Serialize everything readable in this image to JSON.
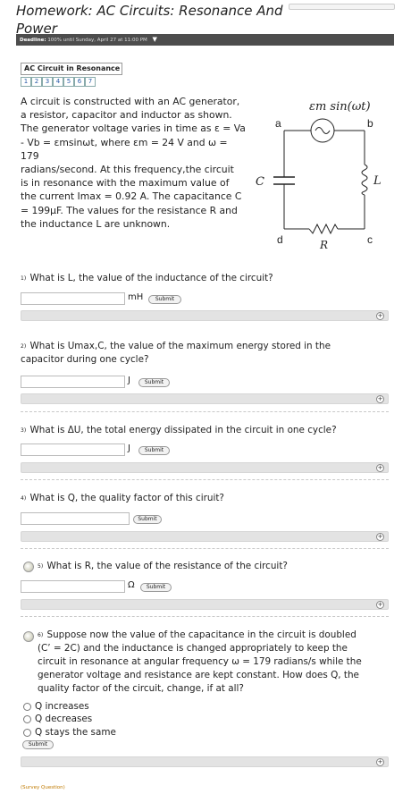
{
  "page": {
    "title": "Homework: AC Circuits: Resonance And Power"
  },
  "deadline": {
    "label": "Deadline:",
    "text": "100% until Sunday, April 27 at 11:00 PM"
  },
  "section": {
    "title": "AC Circuit in Resonance",
    "pages": [
      "1",
      "2",
      "3",
      "4",
      "5",
      "6",
      "7"
    ]
  },
  "problem": {
    "lines": [
      "A circuit is constructed with an AC generator,",
      "a resistor, capacitor and inductor as shown.",
      "The generator voltage varies in time as ε = Va",
      "- Vb = εmsinωt, where εm = 24 V and ω = 179",
      "radians/second. At this frequency,the circuit",
      "is in resonance with the maximum value of",
      "the current Imax = 0.92 A. The capacitance C",
      "= 199μF. The values for the resistance R and",
      "the inductance L are unknown."
    ]
  },
  "circuit": {
    "source_label": "εm sin(ωt)",
    "node_a": "a",
    "node_b": "b",
    "node_c": "c",
    "node_d": "d",
    "cap_label": "C",
    "ind_label": "L",
    "res_label": "R"
  },
  "questions": [
    {
      "num": "1)",
      "text": "What is L, the value of the inductance of the circuit?",
      "unit": "mH",
      "submit": "Submit"
    },
    {
      "num": "2)",
      "text_a": "What is Umax,C, the value of the maximum energy stored in the",
      "text_b": "capacitor during one cycle?",
      "unit": "J",
      "submit": "Submit"
    },
    {
      "num": "3)",
      "text": "What is ΔU, the total energy dissipated in the circuit in one cycle?",
      "unit": "J",
      "submit": "Submit"
    },
    {
      "num": "4)",
      "text": "What is Q, the quality factor of this ciruit?",
      "unit": "",
      "submit": "Submit"
    },
    {
      "num": "5)",
      "text": "What is R, the value of the resistance of the circuit?",
      "unit": "Ω",
      "submit": "Submit"
    },
    {
      "num": "6)",
      "lines": [
        "Suppose now the value of the capacitance in the circuit is doubled",
        "(C’ = 2C) and the inductance is changed appropriately to keep the",
        "circuit in resonance at angular frequency ω = 179 radians/s while the",
        "generator voltage and resistance are kept constant. How does Q, the",
        "quality factor of the circuit, change, if at all?"
      ],
      "options": [
        "Q increases",
        "Q decreases",
        "Q stays the same"
      ],
      "submit": "Submit"
    }
  ],
  "bar_icon": "+",
  "survey": "(Survey Question)"
}
